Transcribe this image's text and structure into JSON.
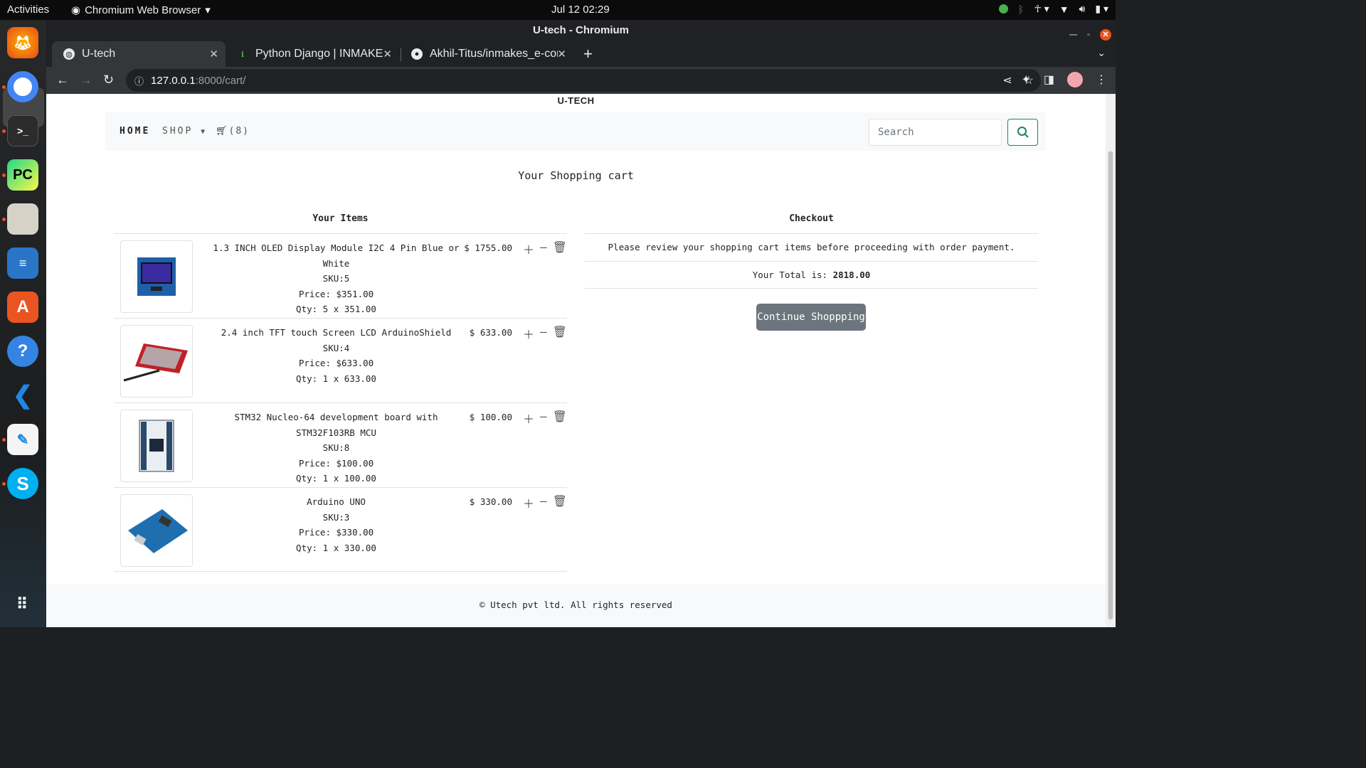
{
  "topbar": {
    "activities": "Activities",
    "app_name": "Chromium Web Browser",
    "clock": "Jul 12  02:29"
  },
  "window": {
    "title": "U-tech - Chromium"
  },
  "tabs": [
    {
      "title": "U-tech"
    },
    {
      "title": "Python Django | INMAKES"
    },
    {
      "title": "Akhil-Titus/inmakes_e-com"
    }
  ],
  "address": {
    "host": "127.0.0.1",
    "path": ":8000/cart/"
  },
  "site": {
    "brand": "U-TECH",
    "nav": {
      "home": "HOME",
      "shop": "SHOP",
      "cart": "(8)"
    },
    "search_placeholder": "Search"
  },
  "cart": {
    "heading": "Your Shopping cart",
    "items_title": "Your Items",
    "items": [
      {
        "name": "1.3 INCH OLED Display Module I2C 4 Pin Blue or White",
        "sku": "SKU:5",
        "price": "Price: $351.00",
        "qty": "Qty: 5 x 351.00",
        "total": "$ 1755.00"
      },
      {
        "name": "2.4 inch TFT touch Screen LCD ArduinoShield",
        "sku": "SKU:4",
        "price": "Price: $633.00",
        "qty": "Qty: 1 x 633.00",
        "total": "$ 633.00"
      },
      {
        "name": "STM32 Nucleo-64 development board with STM32F103RB MCU",
        "sku": "SKU:8",
        "price": "Price: $100.00",
        "qty": "Qty: 1 x 100.00",
        "total": "$ 100.00"
      },
      {
        "name": "Arduino UNO",
        "sku": "SKU:3",
        "price": "Price: $330.00",
        "qty": "Qty: 1 x 330.00",
        "total": "$ 330.00"
      }
    ]
  },
  "checkout": {
    "title": "Checkout",
    "note": "Please review your shopping cart items before proceeding with order payment.",
    "total_label": "Your Total is: ",
    "total_value": "2818.00",
    "continue_label": "Continue Shoppping"
  },
  "footer": {
    "text": "© Utech pvt ltd. All rights reserved"
  },
  "colors": {
    "accent_green": "#198754",
    "button_gray": "#6c757d",
    "ubuntu_orange": "#e95420"
  }
}
